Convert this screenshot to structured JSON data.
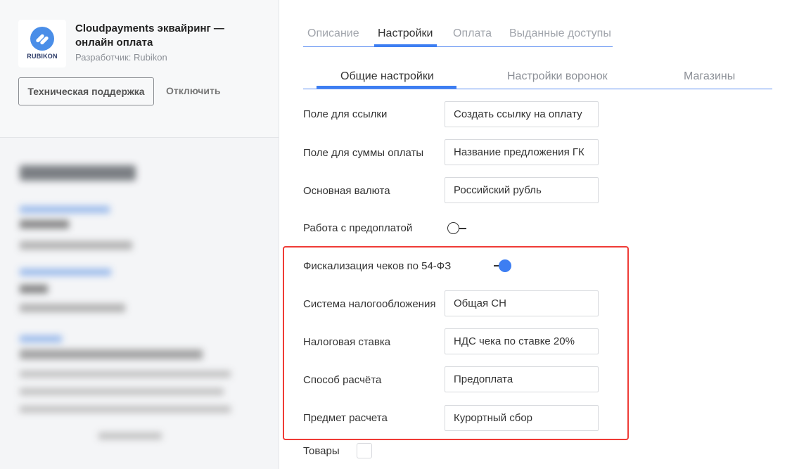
{
  "app": {
    "logo_text": "RUBIKON",
    "title": "Cloudpayments эквайринг — онлайн оплата",
    "developer": "Разработчик: Rubikon",
    "support_button": "Техническая поддержка",
    "disable_button": "Отключить"
  },
  "tabs": [
    {
      "label": "Описание",
      "active": false
    },
    {
      "label": "Настройки",
      "active": true
    },
    {
      "label": "Оплата",
      "active": false
    },
    {
      "label": "Выданные доступы",
      "active": false
    }
  ],
  "subtabs": [
    {
      "label": "Общие настройки",
      "active": true
    },
    {
      "label": "Настройки воронок",
      "active": false
    },
    {
      "label": "Магазины",
      "active": false
    }
  ],
  "settings": {
    "link_field_label": "Поле для ссылки",
    "link_field_value": "Создать ссылку на оплату",
    "amount_field_label": "Поле для суммы оплаты",
    "amount_field_value": "Название предложения ГК",
    "currency_label": "Основная валюта",
    "currency_value": "Российский рубль",
    "prepay_label": "Работа с предоплатой",
    "prepay_enabled": false,
    "fiscal_label": "Фискализация чеков по 54-ФЗ",
    "fiscal_enabled": true,
    "tax_system_label": "Система налогообложения",
    "tax_system_value": "Общая СН",
    "tax_rate_label": "Налоговая ставка",
    "tax_rate_value": "НДС чека по ставке 20%",
    "payment_method_label": "Способ расчёта",
    "payment_method_value": "Предоплата",
    "payment_subject_label": "Предмет расчета",
    "payment_subject_value": "Курортный сбор",
    "goods_label": "Товары",
    "goods_checked": false
  },
  "colors": {
    "accent": "#3d7ef2",
    "highlight": "#ef3b36"
  }
}
